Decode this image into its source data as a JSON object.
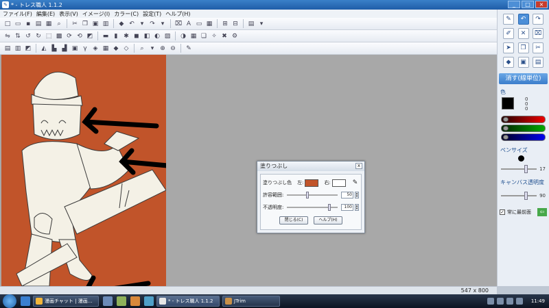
{
  "window": {
    "title": "* - トレス職人 1.1.2"
  },
  "menu": [
    "ファイル(F)",
    "編集(E)",
    "表示(V)",
    "イメージ(I)",
    "カラー(C)",
    "設定(T)",
    "ヘルプ(H)"
  ],
  "panel": {
    "erase_label": "消す(線単位)",
    "color_label": "色",
    "rgb": [
      "0",
      "0",
      "0"
    ],
    "pensize_label": "ペンサイズ",
    "pensize_value": "17",
    "opacity_label": "キャンバス透明度",
    "opacity_value": "90",
    "always_on_top_label": "常に最前面",
    "always_on_top_checked": "✓"
  },
  "dialog": {
    "title": "塗りつぶし",
    "fill_color_label": "塗りつぶし色",
    "front_label": "左:",
    "back_label": "右:",
    "tolerance_label": "許容範囲:",
    "tolerance_value": "50",
    "opacity_label": "不透明度:",
    "opacity_value": "100",
    "close_button": "閉じる(C)",
    "help_button": "ヘルプ(H)",
    "close_x": "x"
  },
  "status": {
    "canvas_size": "547 x 800"
  },
  "taskbar": {
    "tasks": [
      "漫画チャット | 漫画...",
      "* - トレス職人 1.1.2",
      "JTrim"
    ],
    "clock": "11:49"
  },
  "colors": {
    "canvas_bg": "#c1542a",
    "accent": "#3b7dcb"
  }
}
